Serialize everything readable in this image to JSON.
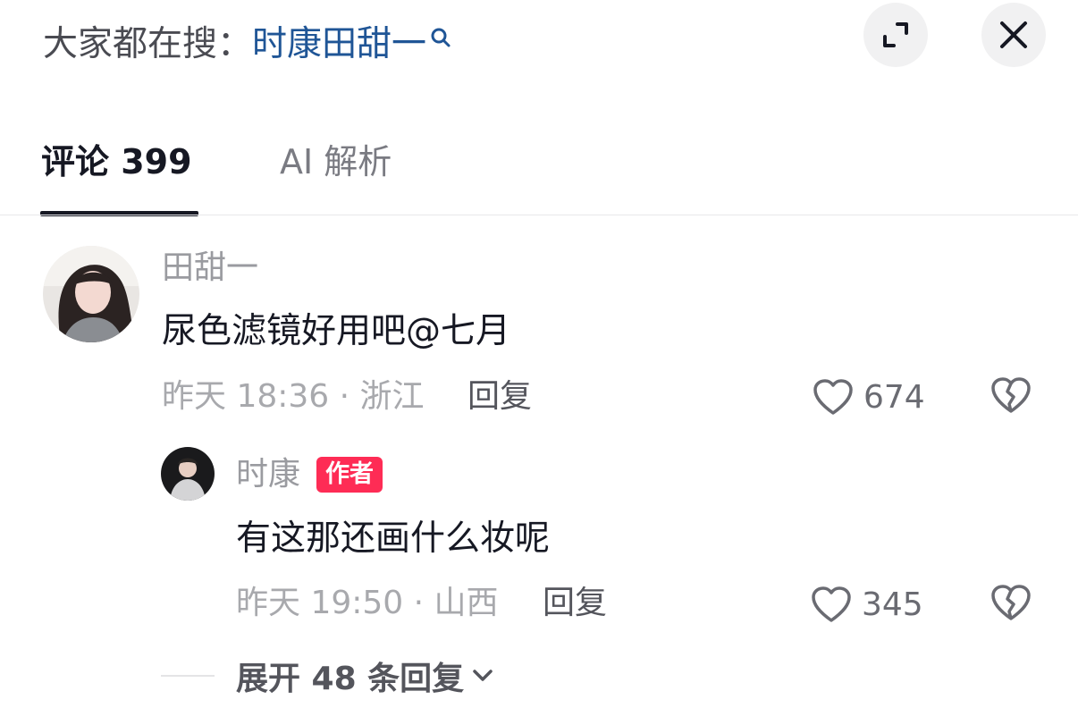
{
  "header": {
    "search_prefix": "大家都在搜：",
    "search_query": "时康田甜一"
  },
  "tabs": [
    {
      "label": "评论 399",
      "active": true
    },
    {
      "label": "AI 解析",
      "active": false
    }
  ],
  "comments": [
    {
      "username": "田甜一",
      "text": "尿色滤镜好用吧@七月",
      "time_location": "昨天 18:36 · 浙江",
      "reply_label": "回复",
      "likes": "674"
    }
  ],
  "replies": [
    {
      "username": "时康",
      "badge": "作者",
      "text": "有这那还画什么妆呢",
      "time_location": "昨天 19:50 · 山西",
      "reply_label": "回复",
      "likes": "345"
    }
  ],
  "expand_label": "展开 48 条回复",
  "colors": {
    "accent_link": "#1f5596",
    "author_badge": "#fe2c55",
    "text_primary": "#161823",
    "text_secondary": "#a8a9ad"
  },
  "icons": [
    "search-icon",
    "expand-icon",
    "close-icon",
    "heart-icon",
    "dislike-heart-icon",
    "chevron-down-icon"
  ]
}
